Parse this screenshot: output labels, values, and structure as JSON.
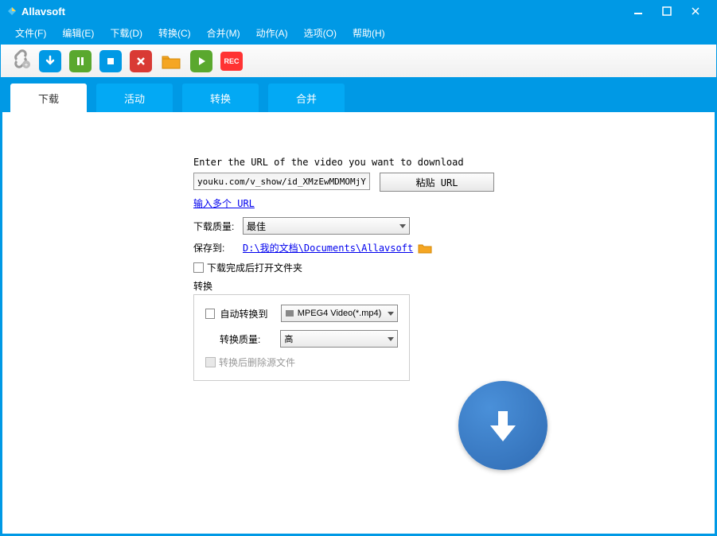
{
  "window": {
    "title": "Allavsoft"
  },
  "menu": {
    "file": "文件(F)",
    "edit": "编辑(E)",
    "download": "下载(D)",
    "convert": "转换(C)",
    "merge": "合并(M)",
    "action": "动作(A)",
    "options": "选项(O)",
    "help": "帮助(H)"
  },
  "toolbar": {
    "rec": "REC"
  },
  "tabs": {
    "download": "下载",
    "activity": "活动",
    "convert": "转换",
    "merge": "合并"
  },
  "form": {
    "prompt": "Enter the URL of the video you want to download",
    "url_value": "youku.com/v_show/id_XMzEwMDMOMjYxMg==.html",
    "paste_btn": "粘贴 URL",
    "multi_url_link": "输入多个 URL",
    "quality_label": "下载质量:",
    "quality_value": "最佳",
    "save_to_label": "保存到:",
    "save_to_path": "D:\\我的文档\\Documents\\Allavsoft",
    "open_after": "下载完成后打开文件夹",
    "convert_group": "转换",
    "auto_convert": "自动转换到",
    "format_value": "MPEG4 Video(*.mp4)",
    "convert_quality_label": "转换质量:",
    "convert_quality_value": "高",
    "delete_source": "转换后删除源文件"
  }
}
